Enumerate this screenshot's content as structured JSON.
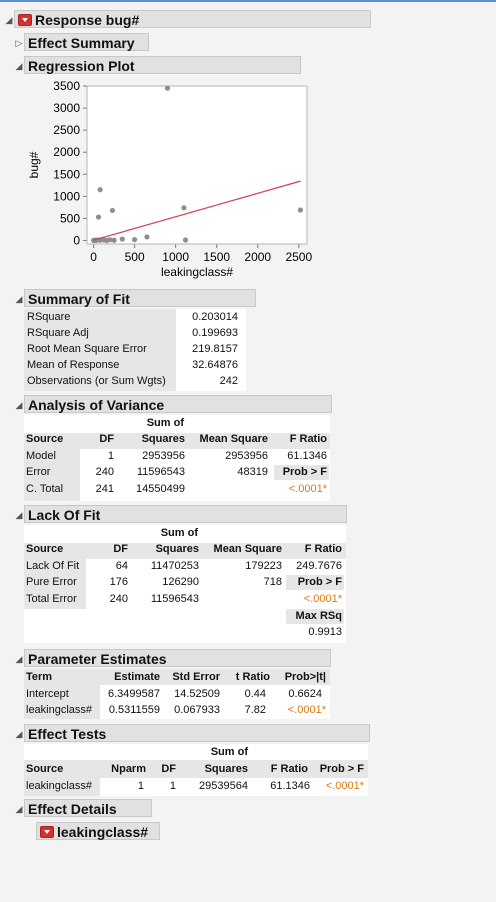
{
  "report": {
    "title": "Response bug#",
    "effect_summary": "Effect Summary",
    "regression_plot": "Regression Plot",
    "summary_of_fit": "Summary of Fit",
    "anova": "Analysis of Variance",
    "lack_of_fit": "Lack Of Fit",
    "param_est": "Parameter Estimates",
    "effect_tests": "Effect Tests",
    "effect_details": "Effect Details",
    "effect_details_item": "leakingclass#"
  },
  "colors": {
    "header_bg": "#e1e1e1",
    "fit_line": "#d04050",
    "pvalue": "#e07a10",
    "accent_red": "#d43030"
  },
  "summary": {
    "labels": [
      "RSquare",
      "RSquare Adj",
      "Root Mean Square Error",
      "Mean of Response",
      "Observations (or Sum Wgts)"
    ],
    "values": [
      "0.203014",
      "0.199693",
      "219.8157",
      "32.64876",
      "242"
    ]
  },
  "anova": {
    "h_source": "Source",
    "h_df": "DF",
    "h_ss1": "Sum of",
    "h_ss2": "Squares",
    "h_ms": "Mean Square",
    "h_f": "F Ratio",
    "model": {
      "source": "Model",
      "df": "1",
      "ss": "2953956",
      "ms": "2953956",
      "f": "61.1346"
    },
    "error": {
      "source": "Error",
      "df": "240",
      "ss": "11596543",
      "ms": "48319",
      "f": "Prob > F"
    },
    "total": {
      "source": "C. Total",
      "df": "241",
      "ss": "14550499",
      "f": "<.0001*"
    }
  },
  "lof": {
    "h_source": "Source",
    "h_df": "DF",
    "h_ss1": "Sum of",
    "h_ss2": "Squares",
    "h_ms": "Mean Square",
    "h_f": "F Ratio",
    "lack": {
      "source": "Lack Of Fit",
      "df": "64",
      "ss": "11470253",
      "ms": "179223",
      "f": "249.7676"
    },
    "pure": {
      "source": "Pure Error",
      "df": "176",
      "ss": "126290",
      "ms": "718",
      "f": "Prob > F"
    },
    "total": {
      "source": "Total Error",
      "df": "240",
      "ss": "11596543",
      "f": "<.0001*"
    },
    "maxrsq_label": "Max RSq",
    "maxrsq": "0.9913"
  },
  "params": {
    "h_term": "Term",
    "h_est": "Estimate",
    "h_se": "Std Error",
    "h_t": "t Ratio",
    "h_p": "Prob>|t|",
    "rows": [
      {
        "term": "Intercept",
        "est": "6.3499587",
        "se": "14.52509",
        "t": "0.44",
        "p": "0.6624"
      },
      {
        "term": "leakingclass#",
        "est": "0.5311559",
        "se": "0.067933",
        "t": "7.82",
        "p": "<.0001*"
      }
    ]
  },
  "tests": {
    "h_source": "Source",
    "h_nparm": "Nparm",
    "h_df": "DF",
    "h_ss1": "Sum of",
    "h_ss2": "Squares",
    "h_f": "F Ratio",
    "h_p": "Prob > F",
    "row": {
      "source": "leakingclass#",
      "nparm": "1",
      "df": "1",
      "ss": "29539564",
      "f": "61.1346",
      "p": "<.0001*"
    }
  },
  "chart_data": {
    "type": "scatter",
    "xlabel": "leakingclass#",
    "ylabel": "bug#",
    "xlim": [
      -80,
      2600
    ],
    "ylim": [
      -80,
      3500
    ],
    "xticks": [
      0,
      500,
      1000,
      1500,
      2000,
      2500
    ],
    "yticks": [
      0,
      500,
      1000,
      1500,
      2000,
      2500,
      3000,
      3500
    ],
    "points": [
      {
        "x": 0,
        "y": 0
      },
      {
        "x": 5,
        "y": 5
      },
      {
        "x": 10,
        "y": 2
      },
      {
        "x": 20,
        "y": 8
      },
      {
        "x": 30,
        "y": 0
      },
      {
        "x": 50,
        "y": 10
      },
      {
        "x": 80,
        "y": 5
      },
      {
        "x": 100,
        "y": 20
      },
      {
        "x": 130,
        "y": 10
      },
      {
        "x": 160,
        "y": 0
      },
      {
        "x": 200,
        "y": 15
      },
      {
        "x": 250,
        "y": 5
      },
      {
        "x": 350,
        "y": 30
      },
      {
        "x": 500,
        "y": 20
      },
      {
        "x": 650,
        "y": 80
      },
      {
        "x": 60,
        "y": 530
      },
      {
        "x": 80,
        "y": 1150
      },
      {
        "x": 230,
        "y": 680
      },
      {
        "x": 900,
        "y": 3450
      },
      {
        "x": 1100,
        "y": 740
      },
      {
        "x": 1120,
        "y": 10
      },
      {
        "x": 2520,
        "y": 690
      }
    ],
    "fit_line": {
      "intercept": 6.3499587,
      "slope": 0.5311559,
      "x_from": 0,
      "x_to": 2520
    }
  }
}
